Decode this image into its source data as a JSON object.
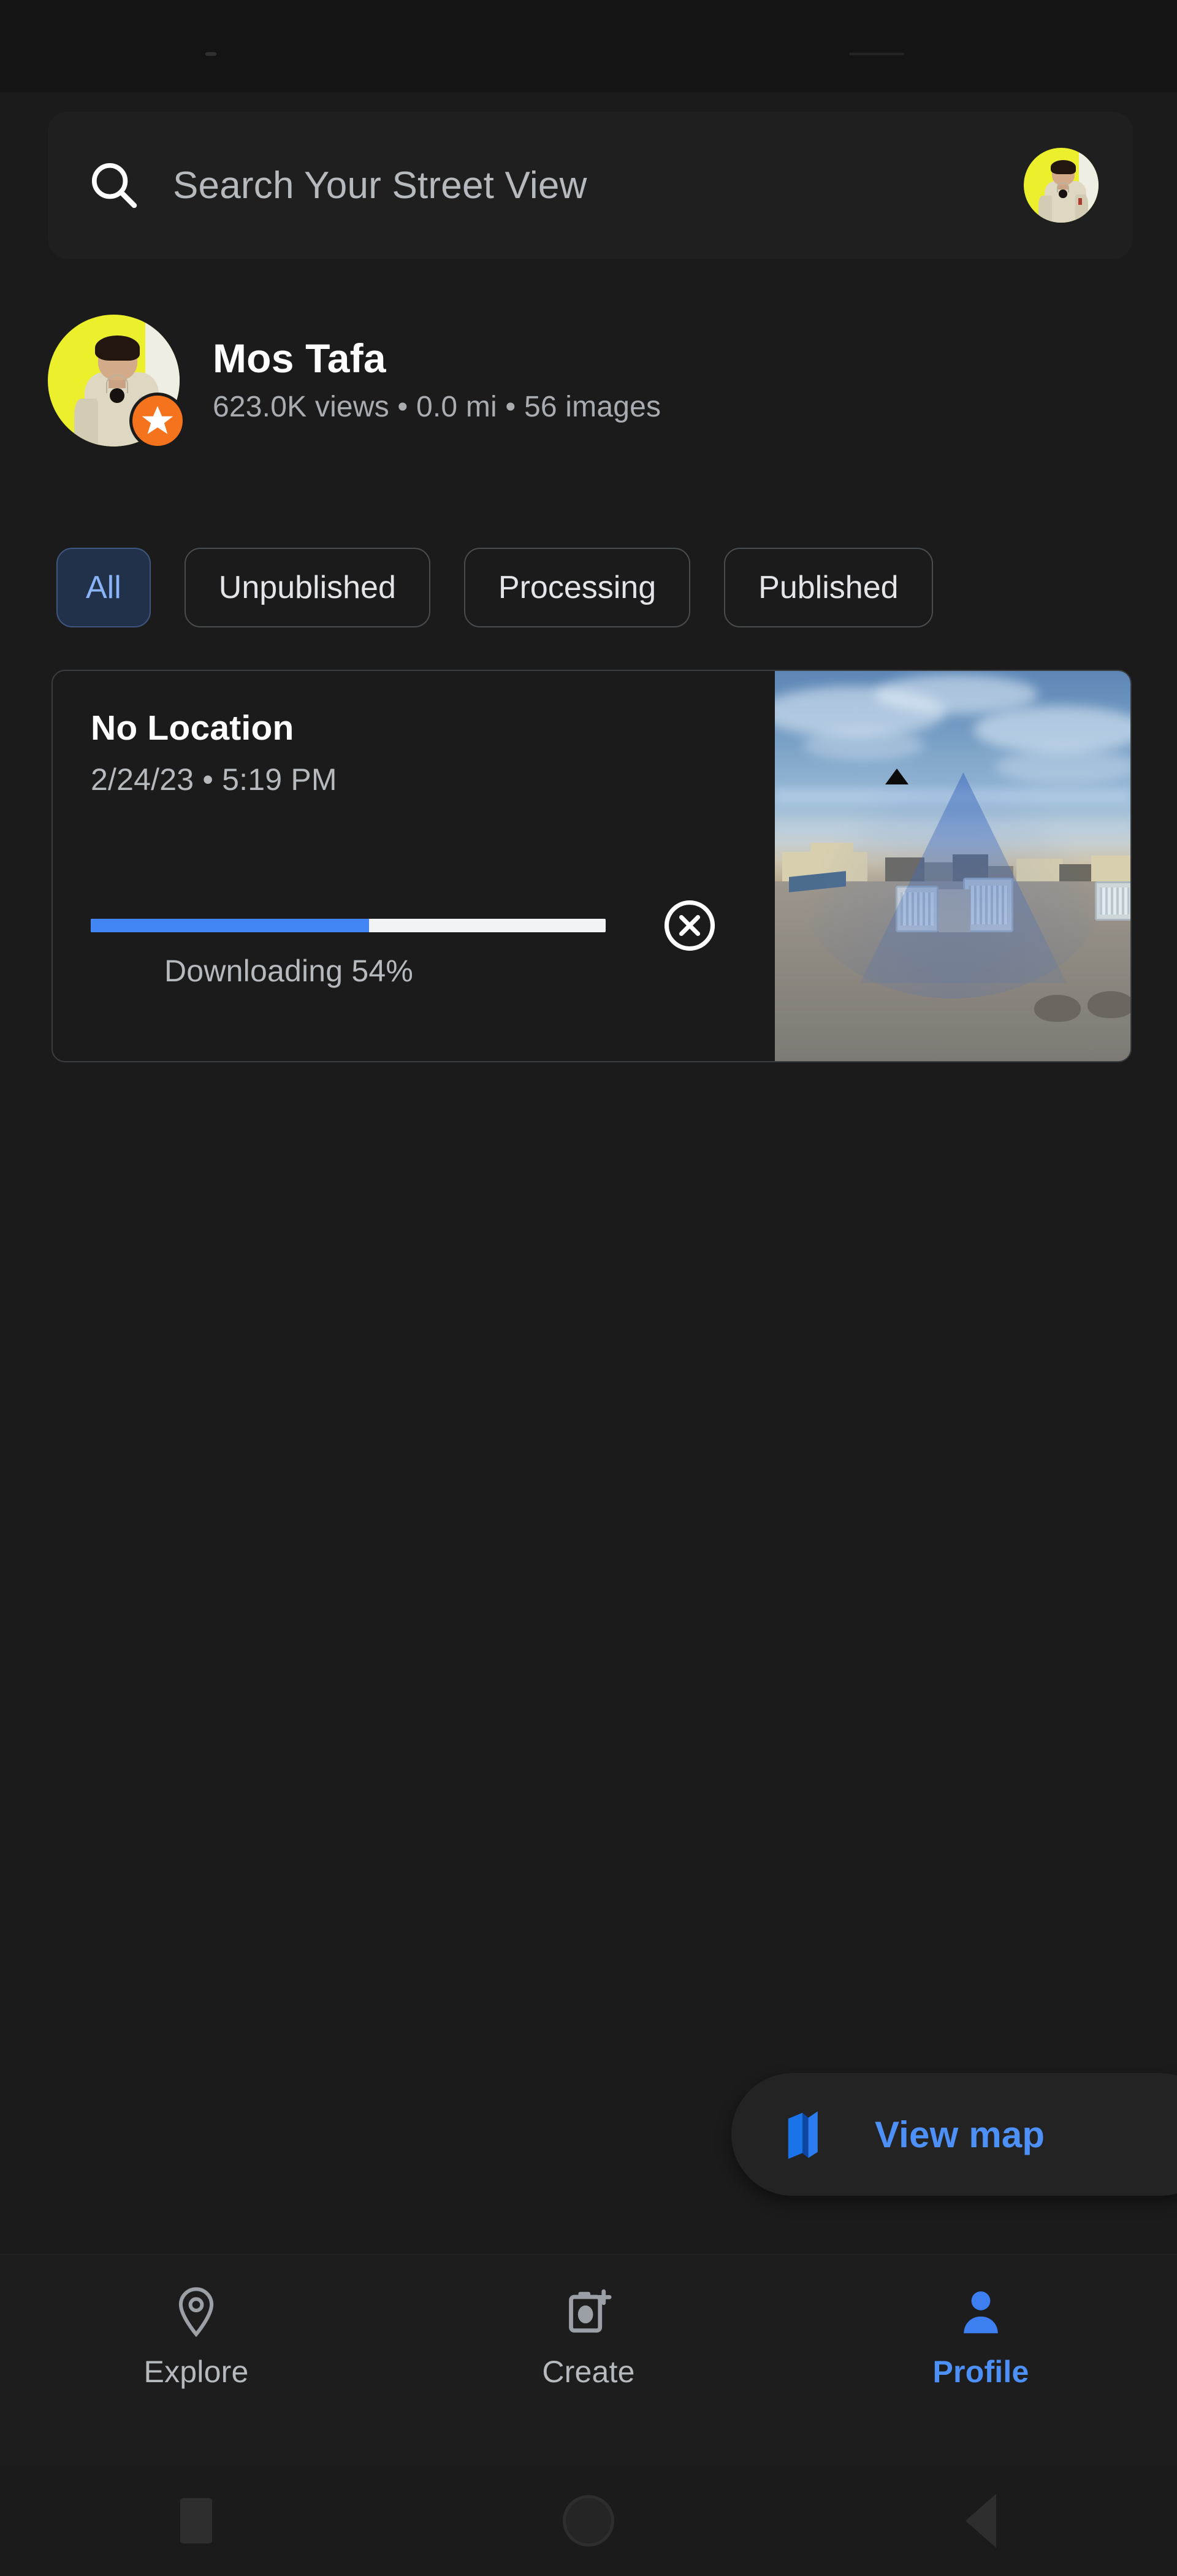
{
  "app": {
    "accent_blue": "#4285F4",
    "link_blue": "#4d90f7",
    "chip_active_blue": "#8ab4f8",
    "badge_orange": "#f4731c",
    "avatar_yellow": "#ecef2b",
    "background": "#1b1b1b"
  },
  "search": {
    "placeholder": "Search Your Street View",
    "icon": "search-icon",
    "avatar_icon": "account-avatar"
  },
  "profile": {
    "name": "Mos Tafa",
    "stats": "623.0K views • 0.0 mi • 56 images",
    "views": "623.0K views",
    "distance": "0.0 mi",
    "images": "56 images",
    "badge_icon": "local-guide-star-badge"
  },
  "filters": {
    "chips": [
      {
        "label": "All",
        "selected": true
      },
      {
        "label": "Unpublished",
        "selected": false
      },
      {
        "label": "Processing",
        "selected": false
      },
      {
        "label": "Published",
        "selected": false
      }
    ]
  },
  "upload_card": {
    "title": "No Location",
    "datetime": "2/24/23 • 5:19 PM",
    "date": "2/24/23",
    "time": "5:19 PM",
    "progress_percent": 54,
    "progress_label": "Downloading 54%",
    "cancel_icon": "cancel-circle-icon",
    "thumbnail_icon": "panorama-thumbnail"
  },
  "fab": {
    "label": "View map",
    "icon": "map-icon"
  },
  "bottom_nav": {
    "items": [
      {
        "label": "Explore",
        "icon": "location-pin-icon",
        "active": false
      },
      {
        "label": "Create",
        "icon": "camera-add-icon",
        "active": false
      },
      {
        "label": "Profile",
        "icon": "person-icon",
        "active": true
      }
    ]
  },
  "system_nav": {
    "recents_icon": "recents-square-icon",
    "home_icon": "home-circle-icon",
    "back_icon": "back-triangle-icon"
  }
}
